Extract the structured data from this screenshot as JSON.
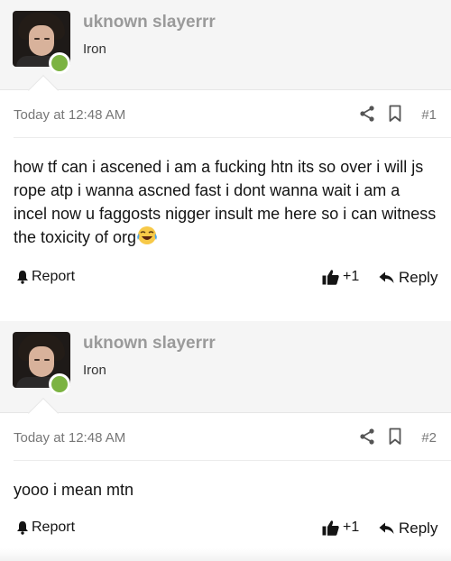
{
  "posts": [
    {
      "username": "uknown slayerrr",
      "user_title": "Iron",
      "timestamp": "Today at 12:48 AM",
      "post_number": "#1",
      "message": "how tf can i ascened i am a fucking htn its so over i will js rope atp i wanna ascned fast i dont wanna wait i am a incel now u faggosts nigger insult me here so i can witness the toxicity of org",
      "trailing_emoji": "crying-laughing-emoji",
      "report_label": "Report",
      "like_count": "+1",
      "reply_label": "Reply"
    },
    {
      "username": "uknown slayerrr",
      "user_title": "Iron",
      "timestamp": "Today at 12:48 AM",
      "post_number": "#2",
      "message": "yooo i mean mtn",
      "report_label": "Report",
      "like_count": "+1",
      "reply_label": "Reply"
    }
  ],
  "colors": {
    "header_bg": "#f5f5f5",
    "online": "#7cb342",
    "username": "#9a9a9a",
    "meta_text": "#777777"
  },
  "icons": [
    "share-icon",
    "bookmark-icon",
    "bell-icon",
    "thumbs-up-icon",
    "reply-arrow-icon"
  ]
}
